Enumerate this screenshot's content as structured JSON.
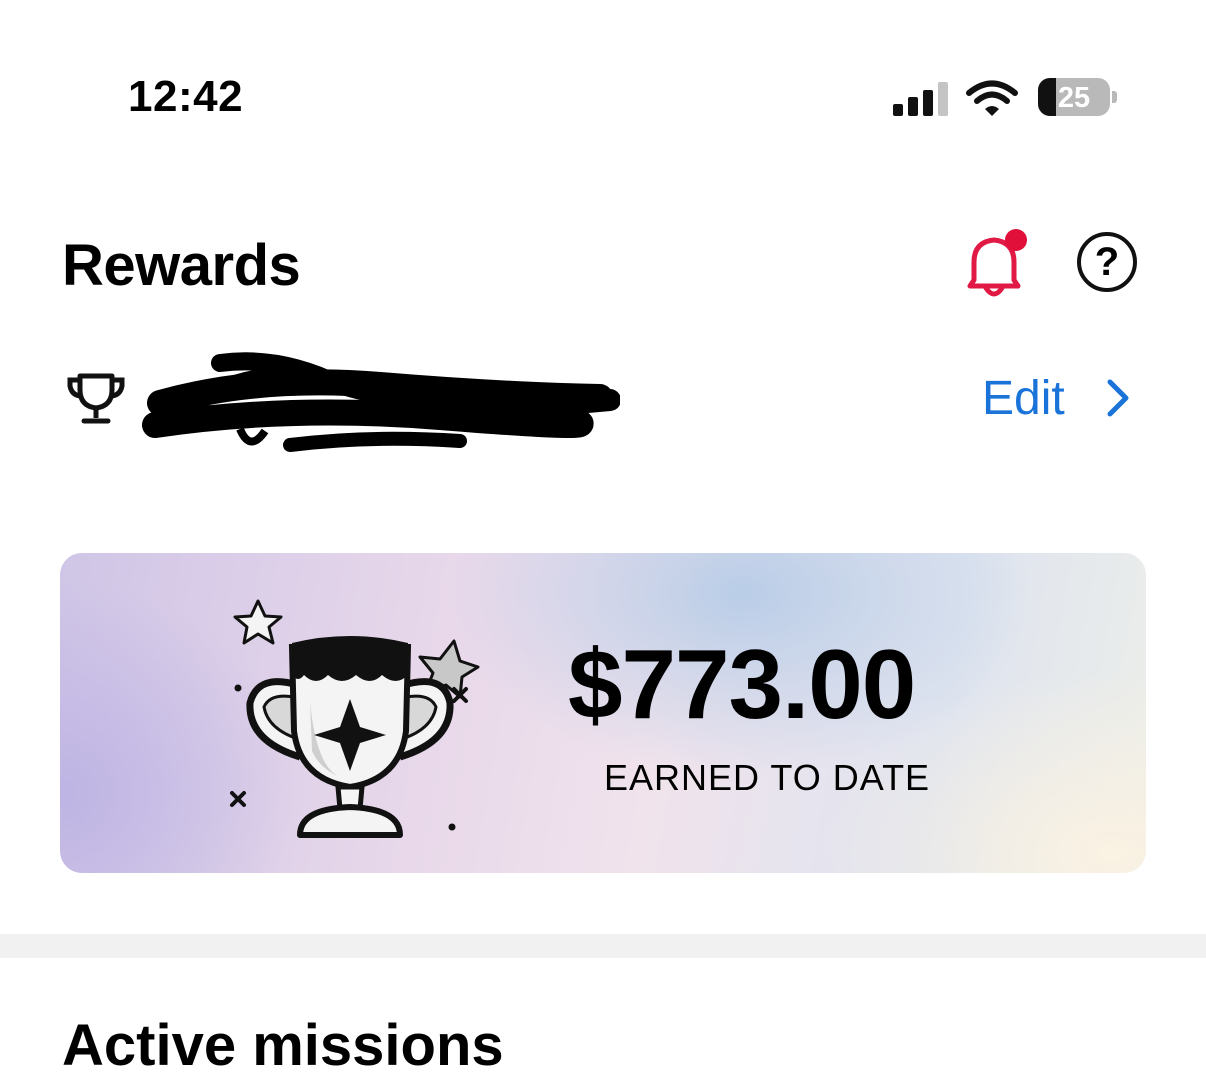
{
  "status_bar": {
    "time": "12:42",
    "battery_level": "25",
    "battery_fraction": 0.25
  },
  "header": {
    "title": "Rewards",
    "notification_icon": "bell-icon",
    "help_icon": "question-circle-icon",
    "help_glyph": "?",
    "notification_dot_color": "#e0103a"
  },
  "profile_row": {
    "icon": "trophy-icon",
    "edit_label": "Edit",
    "edit_color": "#1a73d9"
  },
  "earnings_card": {
    "amount": "$773.00",
    "label": "EARNED TO DATE",
    "illustration": "trophy-with-stars"
  },
  "next_section": {
    "heading": "Active missions"
  }
}
